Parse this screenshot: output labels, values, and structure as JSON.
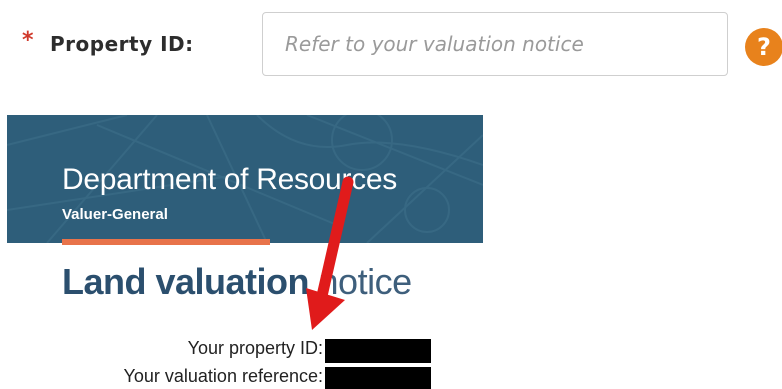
{
  "form": {
    "required_mark": "*",
    "label": "Property ID:",
    "input_placeholder": "Refer to your valuation notice",
    "input_value": "",
    "help_glyph": "?"
  },
  "notice": {
    "department": "Department of Resources",
    "subtitle": "Valuer-General",
    "title_bold": "Land valuation",
    "title_light": " notice",
    "rows": [
      {
        "label": "Your property ID:"
      },
      {
        "label": "Your valuation reference:"
      }
    ]
  },
  "colors": {
    "required": "#d0392b",
    "help_icon": "#e8821c",
    "banner": "#2e5e7a",
    "accent_bar": "#e8734a",
    "arrow": "#e01b1b",
    "title": "#2b4f6e"
  },
  "icons": {
    "help": "question-circle-icon",
    "arrow": "red-pointer-arrow"
  }
}
